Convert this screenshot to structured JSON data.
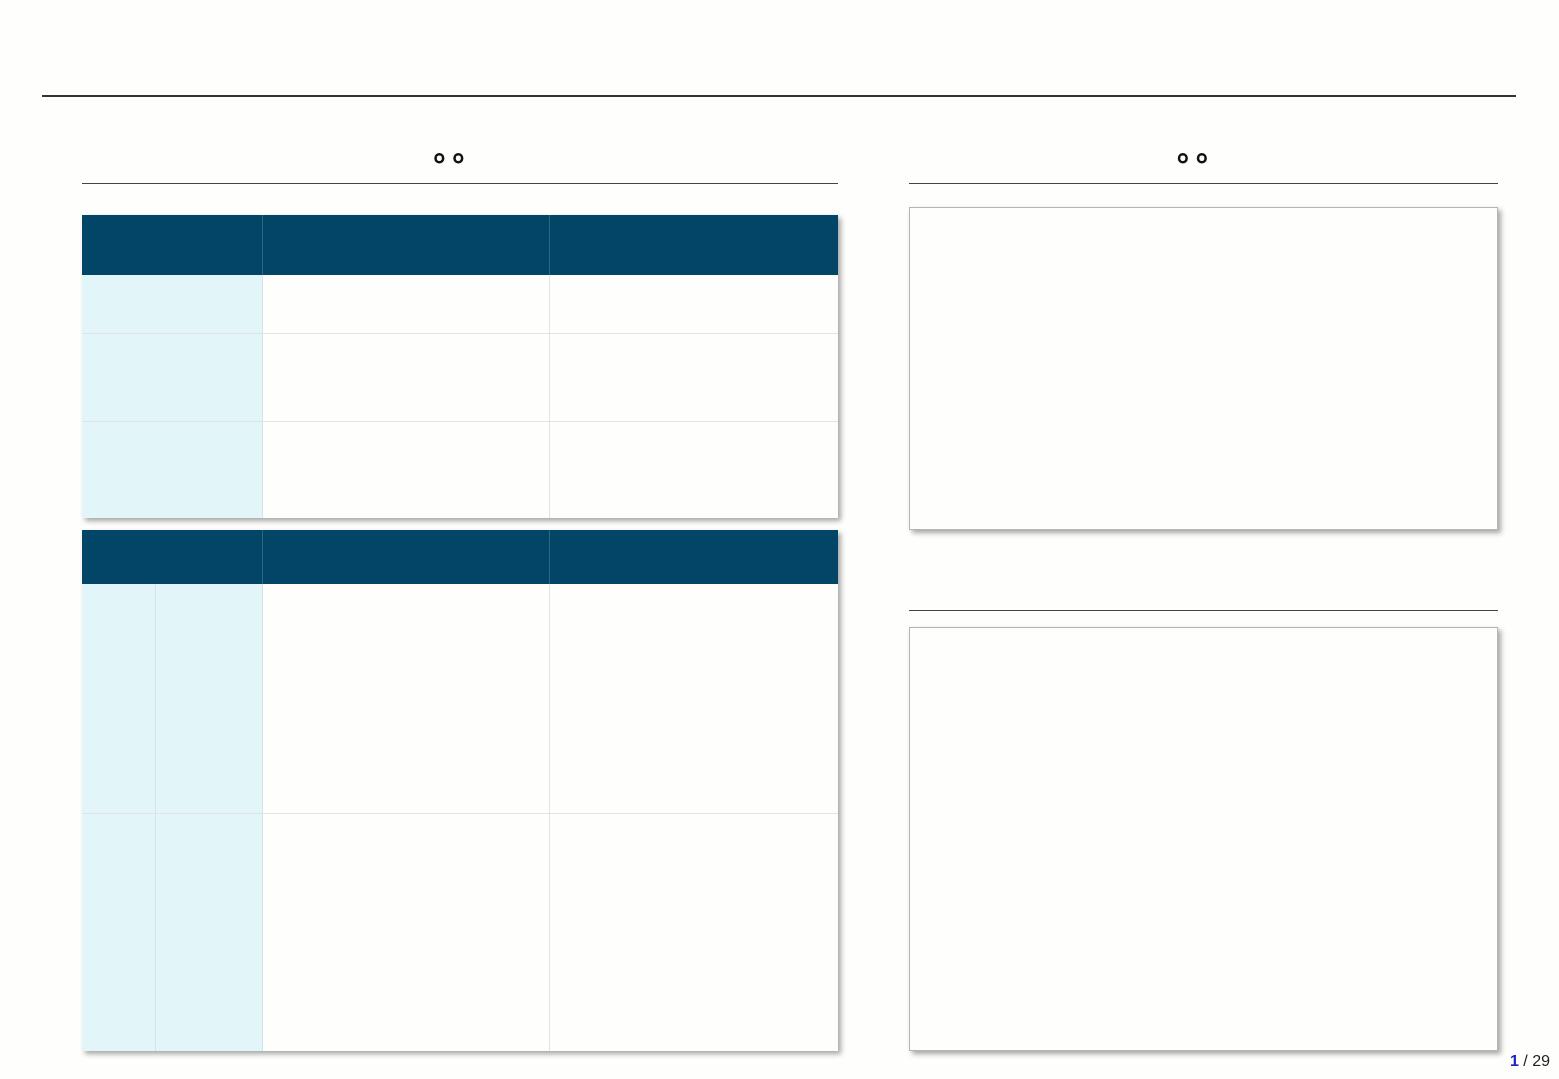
{
  "slide": {
    "left_heading": "。。",
    "right_heading": "。。",
    "table1": {
      "headers": [
        "",
        "",
        ""
      ],
      "rows": [
        [
          "",
          "",
          ""
        ],
        [
          "",
          "",
          ""
        ],
        [
          "",
          "",
          ""
        ]
      ]
    },
    "table2": {
      "headers": [
        "",
        "",
        ""
      ],
      "groups": [
        {
          "key_a": "",
          "key_b": "",
          "col2": "",
          "col3": ""
        },
        {
          "key_a": "",
          "key_b": "",
          "col2": "",
          "col3": ""
        }
      ]
    },
    "panel_top_text": "",
    "panel_bottom_text": ""
  },
  "pager": {
    "current": "1",
    "separator": " / ",
    "total": "29"
  },
  "colors": {
    "header_bg": "#024566",
    "key_cell_bg": "#e2f6fa",
    "page_bg": "#fefefc",
    "pager_current": "#2020c8"
  }
}
